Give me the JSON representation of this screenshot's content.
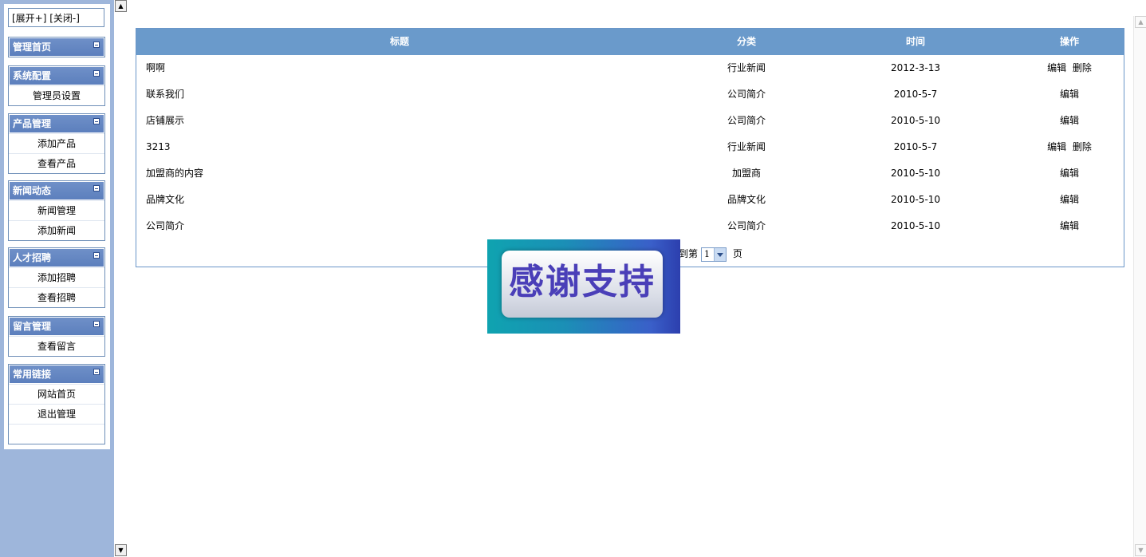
{
  "sidebar": {
    "toggle": {
      "expand": "[展开+]",
      "collapse": "[关闭-]"
    },
    "groups": [
      {
        "title": "管理首页",
        "items": []
      },
      {
        "title": "系统配置",
        "items": [
          "管理员设置"
        ]
      },
      {
        "title": "产品管理",
        "items": [
          "添加产品",
          "查看产品"
        ]
      },
      {
        "title": "新闻动态",
        "items": [
          "新闻管理",
          "添加新闻"
        ]
      },
      {
        "title": "人才招聘",
        "items": [
          "添加招聘",
          "查看招聘"
        ]
      },
      {
        "title": "留言管理",
        "items": [
          "查看留言"
        ]
      },
      {
        "title": "常用链接",
        "items": [
          "网站首页",
          "退出管理"
        ]
      }
    ]
  },
  "table": {
    "headers": {
      "title": "标题",
      "category": "分类",
      "time": "时间",
      "action": "操作"
    },
    "rows": [
      {
        "title": "啊啊",
        "category": "行业新闻",
        "time": "2012-3-13",
        "edit": "编辑",
        "delete": "删除"
      },
      {
        "title": "联系我们",
        "category": "公司简介",
        "time": "2010-5-7",
        "edit": "编辑",
        "delete": ""
      },
      {
        "title": "店铺展示",
        "category": "公司简介",
        "time": "2010-5-10",
        "edit": "编辑",
        "delete": ""
      },
      {
        "title": "3213",
        "category": "行业新闻",
        "time": "2010-5-7",
        "edit": "编辑",
        "delete": "删除"
      },
      {
        "title": "加盟商的内容",
        "category": "加盟商",
        "time": "2010-5-10",
        "edit": "编辑",
        "delete": ""
      },
      {
        "title": "品牌文化",
        "category": "品牌文化",
        "time": "2010-5-10",
        "edit": "编辑",
        "delete": ""
      },
      {
        "title": "公司简介",
        "category": "公司简介",
        "time": "2010-5-10",
        "edit": "编辑",
        "delete": ""
      }
    ]
  },
  "pager": {
    "prefix": "到第",
    "selected": "1",
    "suffix": "页"
  },
  "banner": {
    "text": "感谢支持"
  },
  "colors": {
    "sidebar_bg": "#9eb6db",
    "header_bg": "#6a9acb",
    "menu_head": "#5c7fbd"
  }
}
